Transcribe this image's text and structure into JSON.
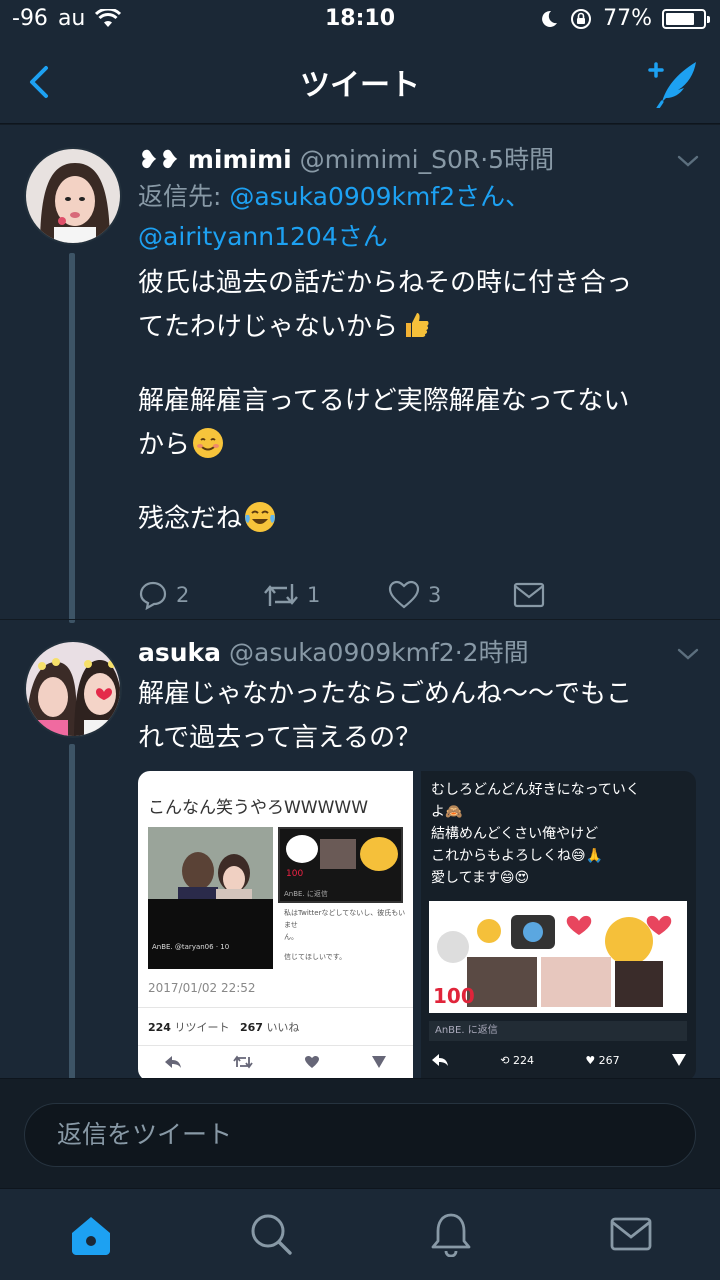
{
  "status_bar": {
    "signal": "-96",
    "carrier": "au",
    "time": "18:10",
    "battery": "77%",
    "battery_level": 0.77
  },
  "nav": {
    "title": "ツイート"
  },
  "tweets": [
    {
      "name": "mimimi",
      "name_prefix": "❥❥",
      "handle": "@mimimi_S0R",
      "time": "5時間",
      "reply_prefix": "返信先:",
      "reply_to_1": "@asuka0909kmf2さん、",
      "reply_to_2": "@airityann1204さん",
      "line1": "彼氏は過去の話だからねその時に付き合っ",
      "line2": "てたわけじゃないから",
      "line3": "解雇解雇言ってるけど実際解雇なってない",
      "line4": "から",
      "line5": "残念だね",
      "reply_count": "2",
      "retweet_count": "1",
      "like_count": "3"
    },
    {
      "name": "asuka",
      "handle": "@asuka0909kmf2",
      "time": "2時間",
      "line1": "解雇じゃなかったならごめんね〜〜でもこ",
      "line2": "れで過去って言えるの？"
    }
  ],
  "media": {
    "left": {
      "heading": "こんなん笑うやろWWWWW",
      "quoted_note_1": "私はTwitterなどしてないし、彼氏もいませ",
      "quoted_note_2": "ん。",
      "quoted_note_3": "信じてほしいです。",
      "profile_caption": "AnBE. @taryan06 · 10",
      "timestamp": "2017/01/02 22:52",
      "retweets": "224",
      "retweets_label": "リツイート",
      "likes": "267",
      "likes_label": "いいね",
      "quoted_author": "AnBE. に返信"
    },
    "right": {
      "line1": "むしろどんどん好きになっていく",
      "line2": "よ🙈",
      "line3": "結構めんどくさい俺やけど",
      "line4": "これからもよろしくね😅🙏",
      "line5": "愛してます😄😍",
      "reply_placeholder": "AnBE. に返信",
      "retweets": "224",
      "likes": "267"
    }
  },
  "reply_box": {
    "placeholder": "返信をツイート"
  },
  "tabs": [
    "home-icon",
    "search-icon",
    "notifications-icon",
    "messages-icon"
  ],
  "colors": {
    "accent": "#1da1f2",
    "background": "#1b2836",
    "muted": "#8899a6"
  }
}
